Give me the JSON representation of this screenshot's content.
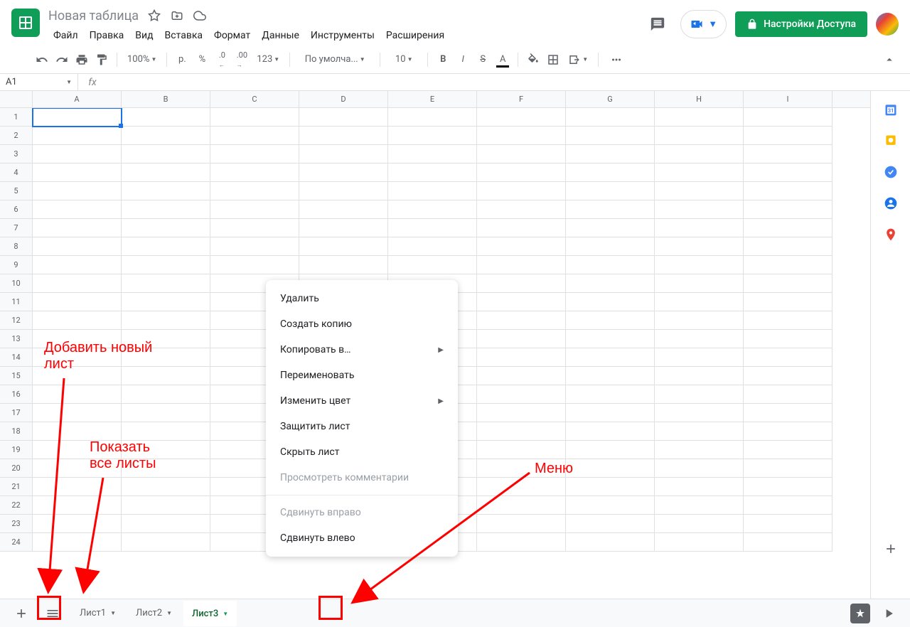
{
  "doc_title": "Новая таблица",
  "menubar": [
    "Файл",
    "Правка",
    "Вид",
    "Вставка",
    "Формат",
    "Данные",
    "Инструменты",
    "Расширения"
  ],
  "share_label": "Настройки Доступа",
  "toolbar": {
    "zoom": "100%",
    "currency": "р.",
    "percent": "%",
    "dec_less": ".0",
    "dec_more": ".00",
    "num_format": "123",
    "font": "По умолча...",
    "font_size": "10"
  },
  "name_box": "A1",
  "columns": [
    "A",
    "B",
    "C",
    "D",
    "E",
    "F",
    "G",
    "H",
    "I"
  ],
  "row_count": 24,
  "sheet_tabs": [
    {
      "label": "Лист1",
      "active": false
    },
    {
      "label": "Лист2",
      "active": false
    },
    {
      "label": "Лист3",
      "active": true
    }
  ],
  "context_menu": [
    {
      "label": "Удалить",
      "type": "item"
    },
    {
      "label": "Создать копию",
      "type": "item"
    },
    {
      "label": "Копировать в…",
      "type": "sub"
    },
    {
      "label": "Переименовать",
      "type": "item"
    },
    {
      "label": "Изменить цвет",
      "type": "sub"
    },
    {
      "label": "Защитить лист",
      "type": "item"
    },
    {
      "label": "Скрыть лист",
      "type": "item"
    },
    {
      "label": "Просмотреть комментарии",
      "type": "disabled"
    },
    {
      "type": "sep"
    },
    {
      "label": "Сдвинуть вправо",
      "type": "disabled"
    },
    {
      "label": "Сдвинуть влево",
      "type": "item"
    }
  ],
  "annotations": {
    "add_sheet": "Добавить новый\nлист",
    "all_sheets": "Показать\nвсе листы",
    "menu": "Меню"
  },
  "side_panel": {
    "calendar_day": "31"
  }
}
